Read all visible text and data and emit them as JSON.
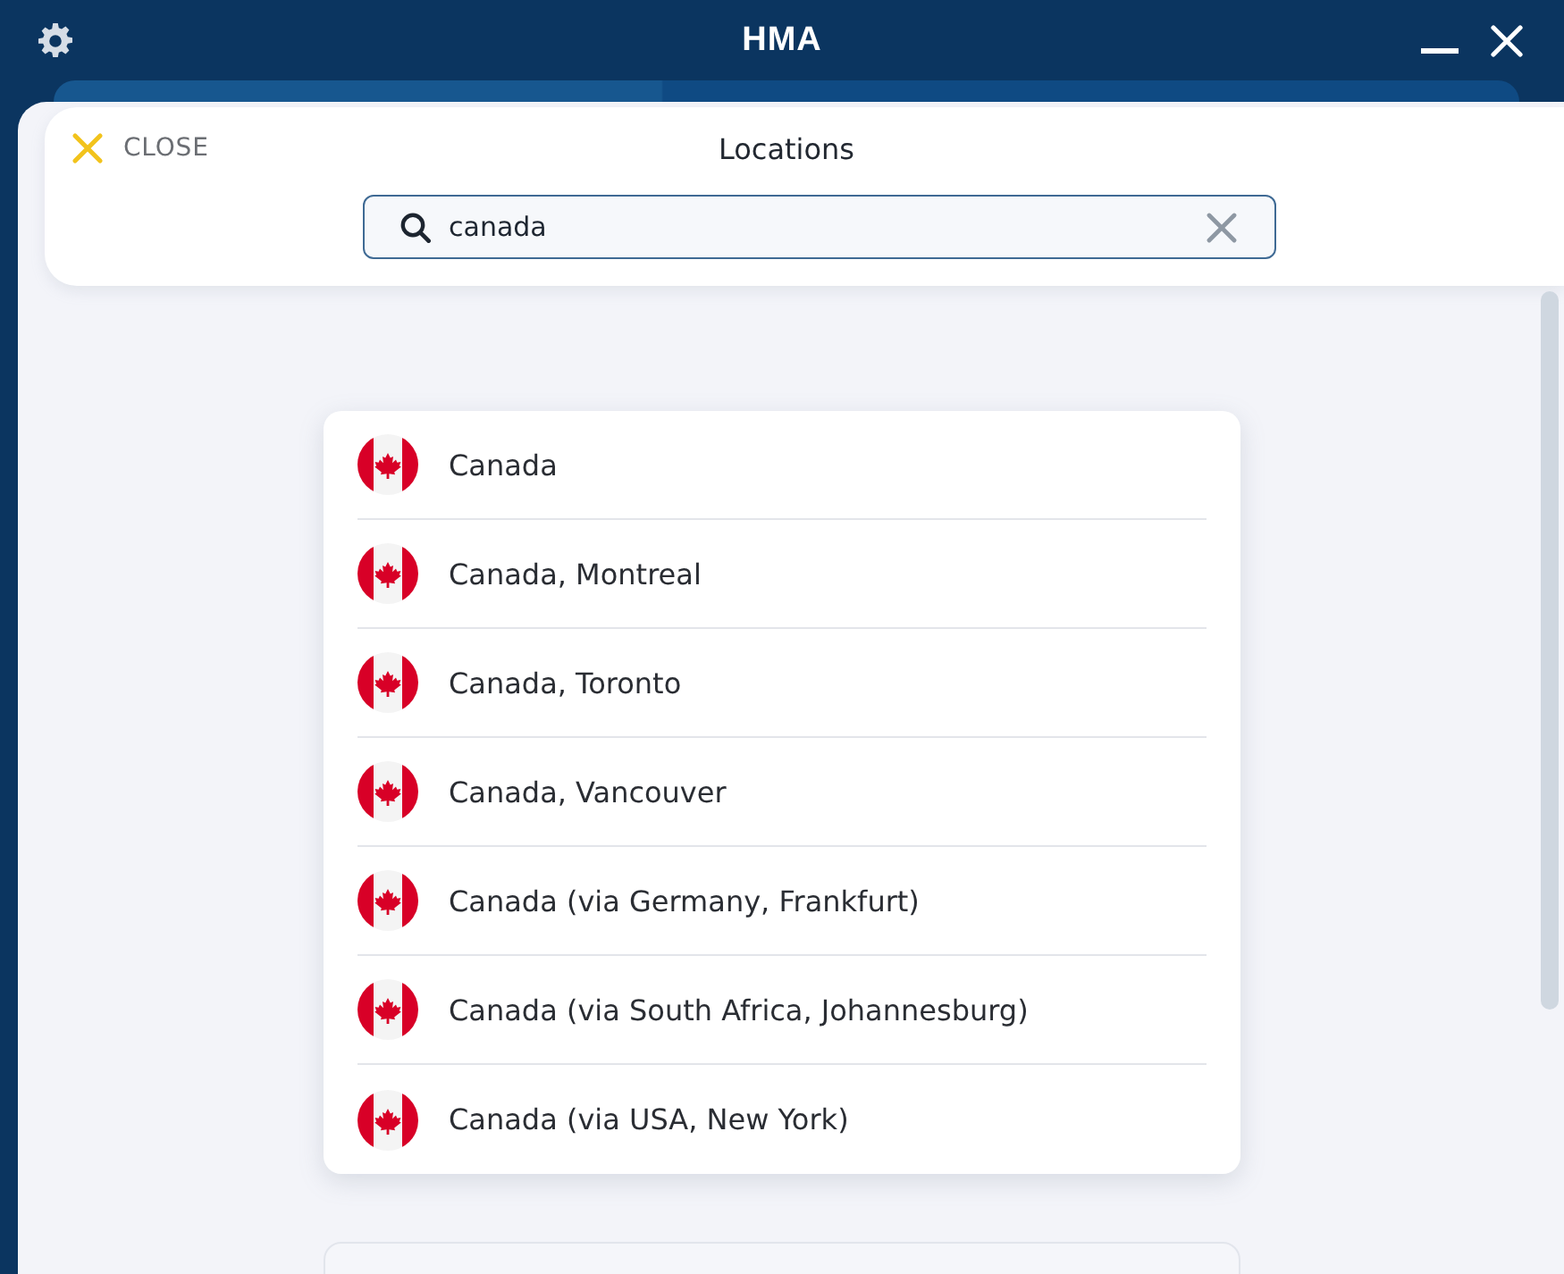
{
  "window": {
    "title": "HMA"
  },
  "header": {
    "close_label": "CLOSE",
    "title": "Locations"
  },
  "search": {
    "value": "canada"
  },
  "locations": [
    {
      "name": "Canada"
    },
    {
      "name": "Canada, Montreal"
    },
    {
      "name": "Canada, Toronto"
    },
    {
      "name": "Canada, Vancouver"
    },
    {
      "name": "Canada (via Germany, Frankfurt)"
    },
    {
      "name": "Canada (via South Africa, Johannesburg)"
    },
    {
      "name": "Canada (via USA, New York)"
    }
  ]
}
